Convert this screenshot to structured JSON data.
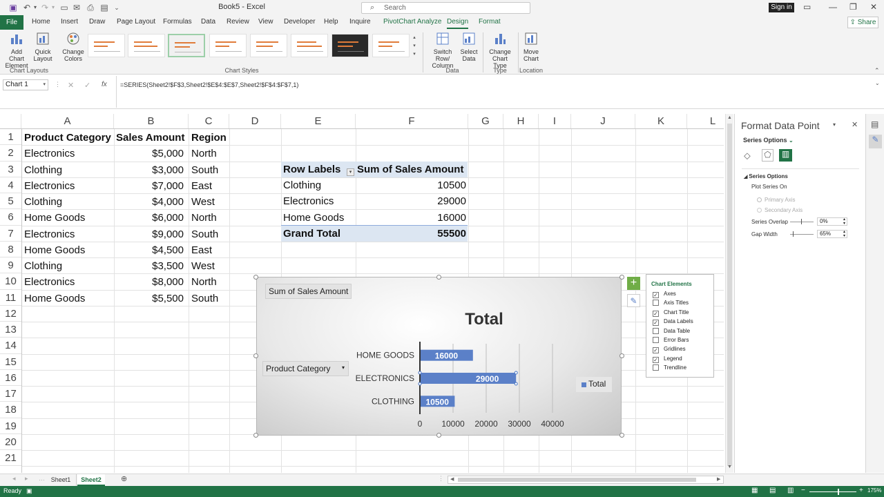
{
  "app": {
    "title": "Book5 - Excel",
    "search_placeholder": "Search",
    "signin": "Sign in",
    "share": "Share"
  },
  "tabs": [
    "File",
    "Home",
    "Insert",
    "Draw",
    "Page Layout",
    "Formulas",
    "Data",
    "Review",
    "View",
    "Developer",
    "Help",
    "Inquire",
    "PivotChart Analyze",
    "Design",
    "Format"
  ],
  "ribbon": {
    "add_chart_element": "Add Chart Element",
    "quick_layout": "Quick Layout",
    "change_colors": "Change Colors",
    "switch_row_col": "Switch Row/ Column",
    "select_data": "Select Data",
    "change_chart_type": "Change Chart Type",
    "move_chart": "Move Chart",
    "group_chart_layouts": "Chart Layouts",
    "group_chart_styles": "Chart Styles",
    "group_data": "Data",
    "group_type": "Type",
    "group_location": "Location"
  },
  "formula_bar": {
    "name_box": "Chart 1",
    "formula": "=SERIES(Sheet2!$F$3,Sheet2!$E$4:$E$7,Sheet2!$F$4:$F$7,1)"
  },
  "columns": [
    "A",
    "B",
    "C",
    "D",
    "E",
    "F",
    "G",
    "H",
    "I",
    "J",
    "K",
    "L"
  ],
  "rows": [
    "1",
    "2",
    "3",
    "4",
    "5",
    "6",
    "7",
    "8",
    "9",
    "10",
    "11",
    "12",
    "13",
    "14",
    "15",
    "16",
    "17",
    "18",
    "19",
    "20",
    "21"
  ],
  "table": {
    "headers": [
      "Product Category",
      "Sales Amount",
      "Region"
    ],
    "rows": [
      [
        "Electronics",
        "$5,000",
        "North"
      ],
      [
        "Clothing",
        "$3,000",
        "South"
      ],
      [
        "Electronics",
        "$7,000",
        "East"
      ],
      [
        "Clothing",
        "$4,000",
        "West"
      ],
      [
        "Home Goods",
        "$6,000",
        "North"
      ],
      [
        "Electronics",
        "$9,000",
        "South"
      ],
      [
        "Home Goods",
        "$4,500",
        "East"
      ],
      [
        "Clothing",
        "$3,500",
        "West"
      ],
      [
        "Electronics",
        "$8,000",
        "North"
      ],
      [
        "Home Goods",
        "$5,500",
        "South"
      ]
    ]
  },
  "pivot": {
    "row_labels": "Row Labels",
    "sum_header": "Sum of Sales Amount",
    "rows": [
      [
        "Clothing",
        "10500"
      ],
      [
        "Electronics",
        "29000"
      ],
      [
        "Home Goods",
        "16000"
      ]
    ],
    "grand_total_label": "Grand Total",
    "grand_total_value": "55500"
  },
  "chart_buttons": {
    "sum_field": "Sum of Sales Amount",
    "axis_field": "Product Category"
  },
  "chart_data": {
    "type": "bar",
    "title": "Total",
    "categories": [
      "HOME GOODS",
      "ELECTRONICS",
      "CLOTHING"
    ],
    "series": [
      {
        "name": "Total",
        "values": [
          16000,
          29000,
          10500
        ]
      }
    ],
    "xlim": [
      0,
      40000
    ],
    "xticks": [
      "0",
      "10000",
      "20000",
      "30000",
      "40000"
    ],
    "gridlines": true,
    "legend": "right",
    "bar_color": "#5b80c8"
  },
  "chart_elements": {
    "title": "Chart Elements",
    "items": [
      {
        "label": "Axes",
        "checked": true
      },
      {
        "label": "Axis Titles",
        "checked": false
      },
      {
        "label": "Chart Title",
        "checked": true
      },
      {
        "label": "Data Labels",
        "checked": true
      },
      {
        "label": "Data Table",
        "checked": false
      },
      {
        "label": "Error Bars",
        "checked": false
      },
      {
        "label": "Gridlines",
        "checked": true
      },
      {
        "label": "Legend",
        "checked": true
      },
      {
        "label": "Trendline",
        "checked": false
      }
    ]
  },
  "format_pane": {
    "title": "Format Data Point",
    "dropdown": "Series Options",
    "section": "Series Options",
    "plot_series_on": "Plot Series On",
    "primary_axis": "Primary Axis",
    "secondary_axis": "Secondary Axis",
    "overlap_label": "Series Overlap",
    "overlap_value": "0%",
    "gap_label": "Gap Width",
    "gap_value": "65%"
  },
  "sheets": [
    "Sheet1",
    "Sheet2"
  ],
  "status": {
    "ready": "Ready",
    "zoom": "175%"
  },
  "colors": {
    "accent": "#217346",
    "pivot_header": "#dce6f2"
  }
}
